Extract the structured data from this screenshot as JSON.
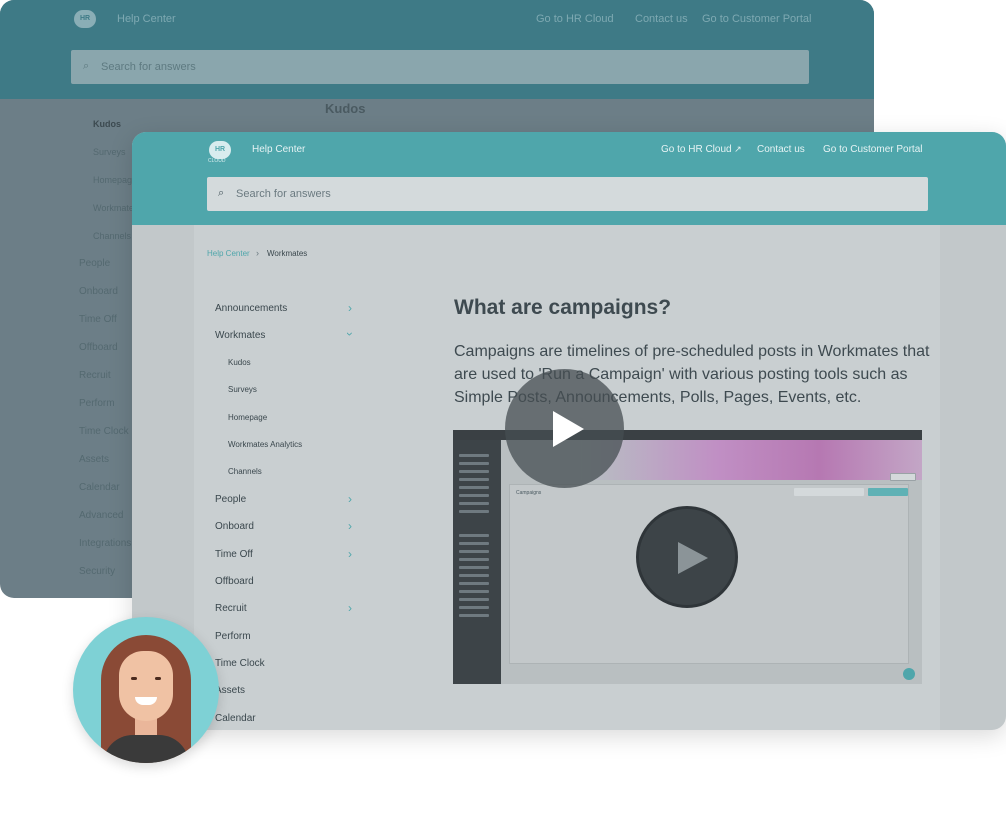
{
  "back": {
    "header": {
      "logo_text": "HR",
      "help_center": "Help Center",
      "nav": [
        "Go to HR Cloud",
        "Contact us",
        "Go to Customer Portal"
      ]
    },
    "search_placeholder": "Search for answers",
    "article_title": "Kudos",
    "sidebar_sub": [
      "Kudos",
      "Surveys",
      "Homepage",
      "Workmates",
      "Channels"
    ],
    "sidebar_cats": [
      "People",
      "Onboard",
      "Time Off",
      "Offboard",
      "Recruit",
      "Perform",
      "Time Clock",
      "Assets",
      "Calendar",
      "Advanced",
      "Integrations",
      "Security"
    ]
  },
  "front": {
    "header": {
      "logo_text": "HR",
      "logo_sub": "CLOUD",
      "help_center": "Help Center",
      "nav": [
        "Go to HR Cloud",
        "Contact us",
        "Go to Customer Portal"
      ]
    },
    "search_placeholder": "Search for answers",
    "breadcrumb": {
      "home": "Help Center",
      "current": "Workmates"
    },
    "sidebar": {
      "announcements": "Announcements",
      "workmates": "Workmates",
      "sub": [
        "Kudos",
        "Surveys",
        "Homepage",
        "Workmates Analytics",
        "Channels"
      ],
      "people": "People",
      "onboard": "Onboard",
      "time_off": "Time Off",
      "offboard": "Offboard",
      "recruit": "Recruit",
      "perform": "Perform",
      "time_clock": "Time Clock",
      "assets": "Assets",
      "calendar": "Calendar"
    },
    "article": {
      "title": "What are campaigns?",
      "body": "Campaigns are timelines of pre-scheduled posts in Workmates that are used to 'Run a Campaign' with various posting tools such as Simple Posts, Announcements, Polls, Pages, Events, etc."
    },
    "video": {
      "inner_title": "Campaigns"
    }
  },
  "icons": {
    "search": "search-icon",
    "chevron_right": "chevron-right-icon",
    "chevron_down": "chevron-down-icon",
    "play": "play-icon",
    "external": "external-link-icon"
  },
  "colors": {
    "brand_teal": "#4fa6ab",
    "dim_teal": "#3e7a86",
    "text_dark": "#3e4a50"
  }
}
